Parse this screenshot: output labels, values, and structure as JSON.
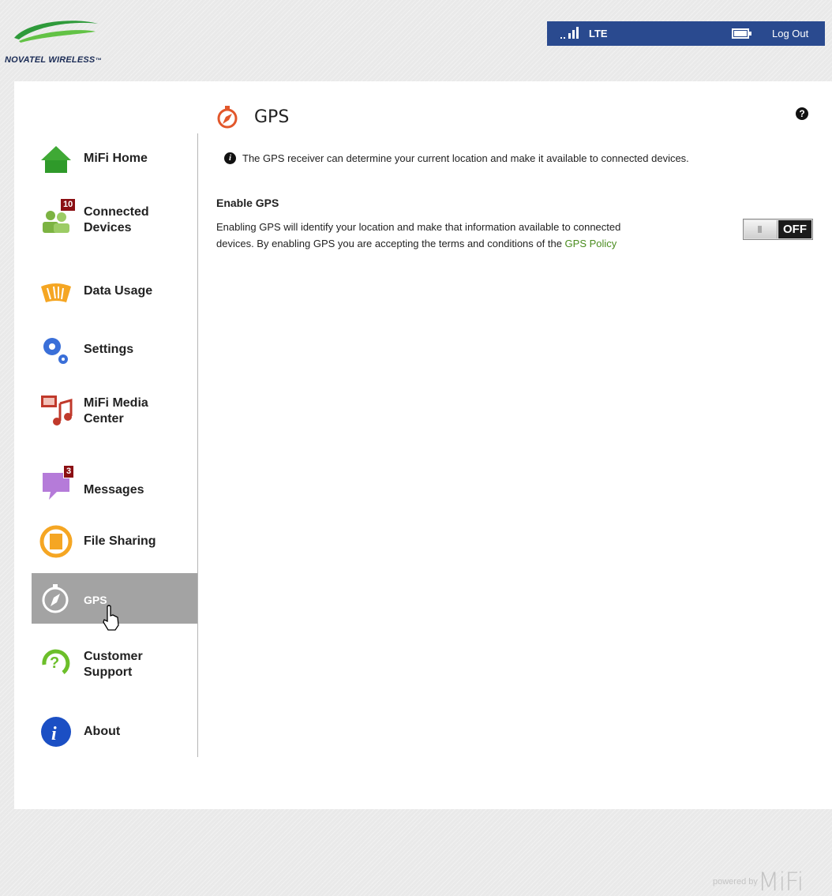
{
  "header": {
    "logo_text": "NOVATEL WIRELESS",
    "logo_tm": "™",
    "network": "LTE",
    "logout_label": "Log Out",
    "signal_bars": 3,
    "battery_level": 1.0,
    "status_color": "#2a4a8f"
  },
  "sidebar": {
    "items": [
      {
        "label": "MiFi Home",
        "icon": "home-icon"
      },
      {
        "label": "Connected Devices",
        "label_line1": "Connected",
        "label_line2": "Devices",
        "icon": "connected-devices-icon",
        "badge": "10"
      },
      {
        "label": "Data Usage",
        "icon": "data-usage-icon"
      },
      {
        "label": "Settings",
        "icon": "settings-icon"
      },
      {
        "label": "MiFi Media Center",
        "label_line1": "MiFi Media",
        "label_line2": "Center",
        "icon": "media-center-icon"
      },
      {
        "label": "Messages",
        "icon": "messages-icon",
        "badge": "3"
      },
      {
        "label": "File Sharing",
        "icon": "file-sharing-icon"
      },
      {
        "label": "GPS",
        "icon": "gps-icon",
        "active": true
      },
      {
        "label": "Customer Support",
        "label_line1": "Customer",
        "label_line2": "Support",
        "icon": "customer-support-icon"
      },
      {
        "label": "About",
        "icon": "about-icon"
      }
    ]
  },
  "main": {
    "title": "GPS",
    "info": "The GPS receiver can determine your current location and make it available to connected devices.",
    "section_title": "Enable GPS",
    "section_desc_line1": "Enabling GPS will identify your location and make that information available to connected",
    "section_desc_line2": "devices. By enabling GPS you are accepting the terms and conditions of the ",
    "policy_link": "GPS Policy",
    "toggle_state": "OFF"
  },
  "footer": {
    "powered_by": "powered by",
    "brand": "MiFi"
  }
}
